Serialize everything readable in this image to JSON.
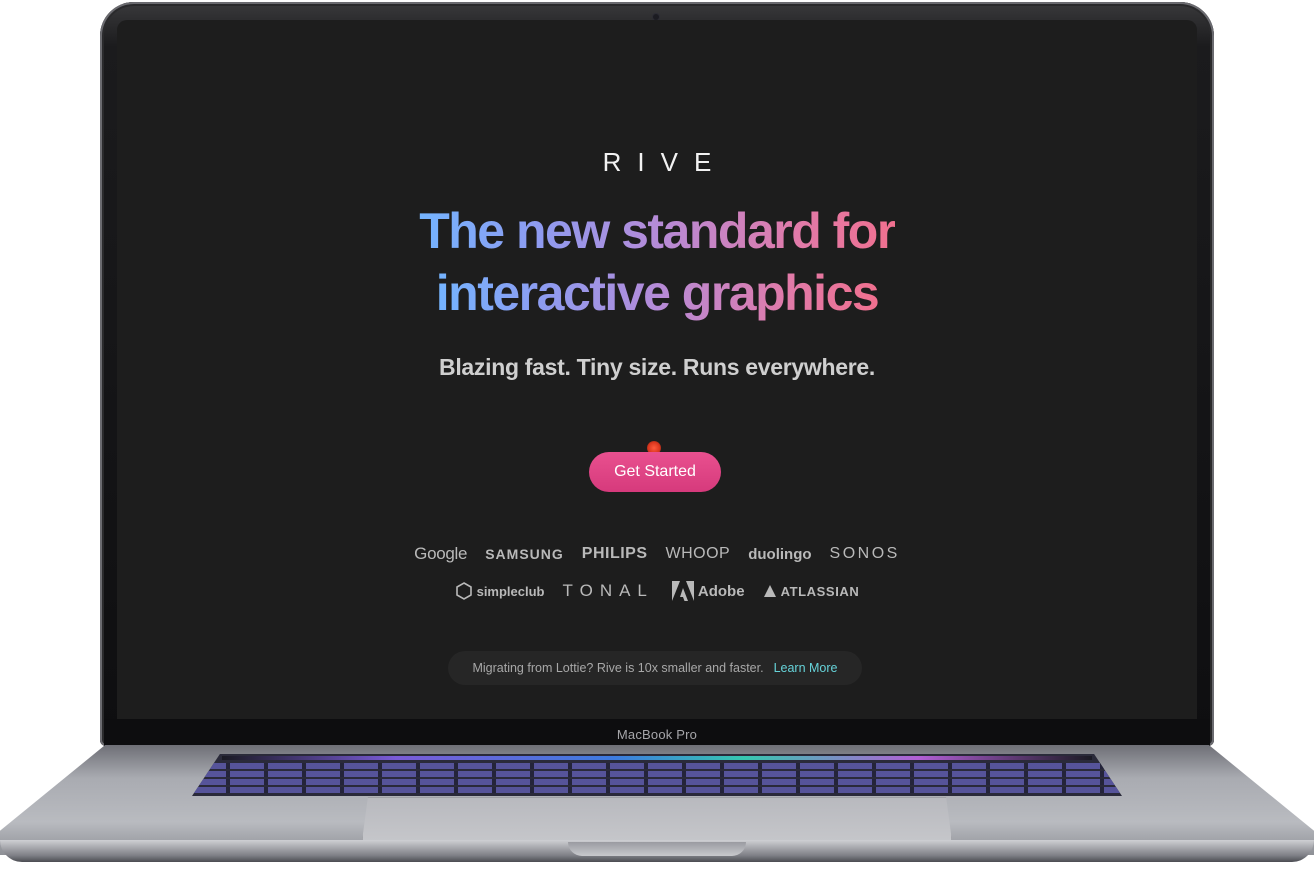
{
  "device": {
    "model_label": "MacBook Pro"
  },
  "page": {
    "logo": "RIVE",
    "headline": {
      "line1": "The new standard for",
      "line2": "interactive graphics"
    },
    "subheadline": "Blazing fast. Tiny size. Runs everywhere.",
    "cta_label": "Get Started",
    "partner_logos": {
      "row1": [
        "Google",
        "SAMSUNG",
        "PHILIPS",
        "WHOOP",
        "duolingo",
        "SONOS"
      ],
      "row2": [
        "simpleclub",
        "TONAL",
        "Adobe",
        "ATLASSIAN"
      ]
    },
    "notice": {
      "text": "Migrating from Lottie? Rive is 10x smaller and faster.",
      "link": "Learn More"
    }
  },
  "colors": {
    "screen_bg": "#1d1d1d",
    "cta_bg": "#e0467f",
    "headline_gradient_start": "#74b4ff",
    "headline_gradient_end": "#f0708f",
    "link": "#66d3d9"
  },
  "icons": [
    "simpleclub-hexagon-icon",
    "adobe-logo-icon",
    "atlassian-logo-icon",
    "cursor-indicator-icon"
  ]
}
